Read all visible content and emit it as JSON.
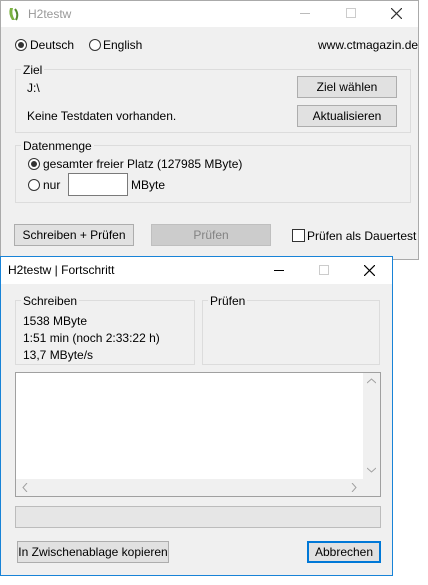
{
  "main": {
    "title": "H2testw",
    "language": {
      "deutsch": "Deutsch",
      "english": "English",
      "selected": "Deutsch"
    },
    "website": "www.ctmagazin.de",
    "ziel": {
      "legend": "Ziel",
      "path": "J:\\",
      "status": "Keine Testdaten vorhanden.",
      "choose_label": "Ziel wählen",
      "refresh_label": "Aktualisieren"
    },
    "datenmenge": {
      "legend": "Datenmenge",
      "all_free_label": "gesamter freier Platz (127985 MByte)",
      "only_label": "nur",
      "only_value": "",
      "unit": "MByte"
    },
    "buttons": {
      "write_verify": "Schreiben + Prüfen",
      "verify": "Prüfen"
    },
    "continuous_label": "Prüfen als Dauertest"
  },
  "progress": {
    "title": "H2testw | Fortschritt",
    "write": {
      "legend": "Schreiben",
      "amount": "1538 MByte",
      "time": "1:51 min (noch 2:33:22 h)",
      "speed": "13,7 MByte/s"
    },
    "verify": {
      "legend": "Prüfen"
    },
    "log_text": "",
    "progress_fraction": 0.0,
    "buttons": {
      "copy": "In Zwischenablage kopieren",
      "cancel": "Abbrechen"
    }
  }
}
